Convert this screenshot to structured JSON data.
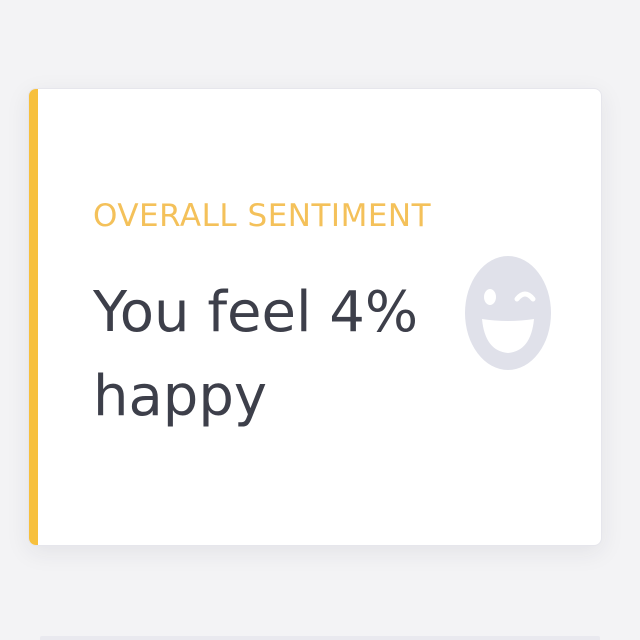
{
  "card": {
    "eyebrow": "OVERALL SENTIMENT",
    "headline": "You feel 4% happy",
    "sentiment_percent": 4,
    "icon": "winking-smile-icon"
  },
  "colors": {
    "accent": "#f7c03d",
    "eyebrow": "#f4c15a",
    "headline": "#3d3f4a",
    "icon": "#e0e1ea"
  }
}
